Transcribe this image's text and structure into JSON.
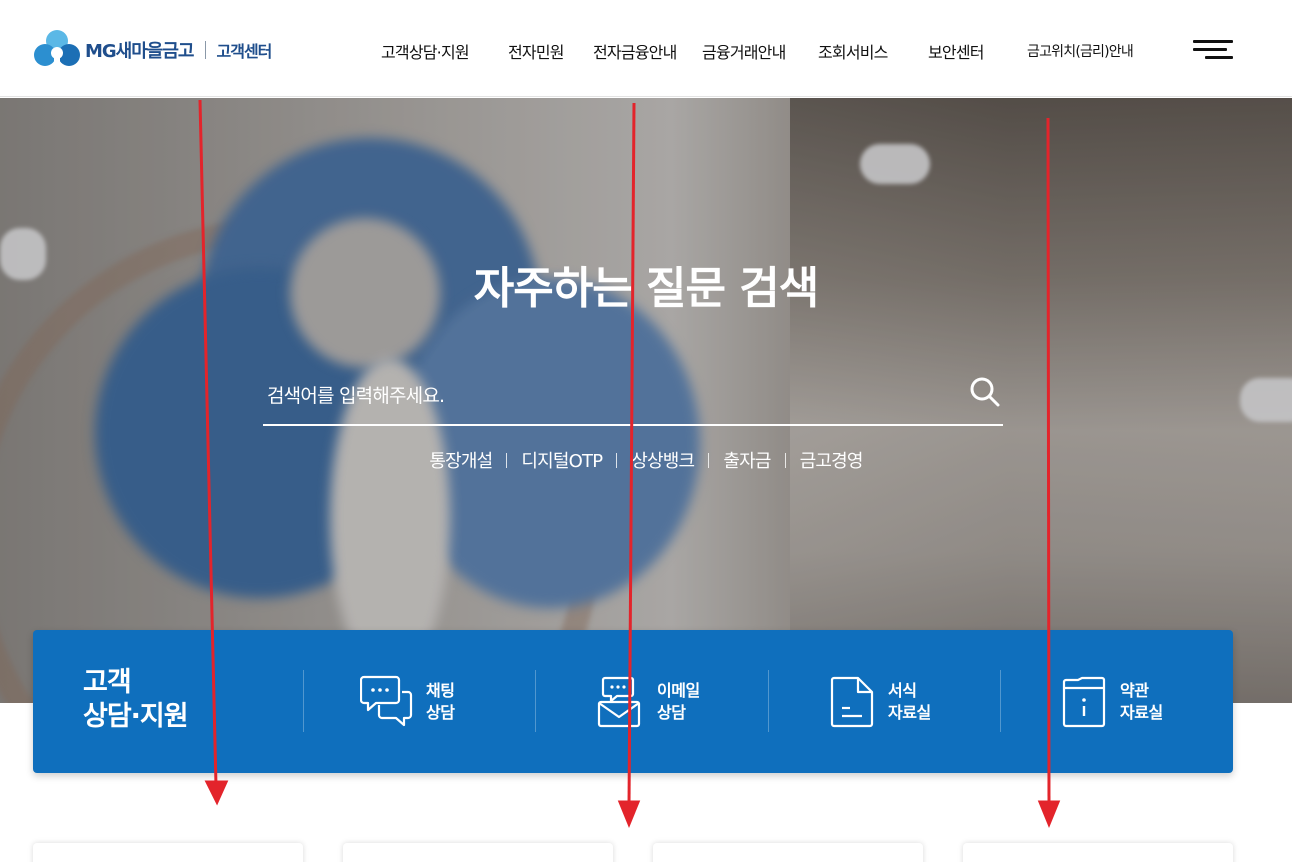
{
  "header": {
    "logo_text": "MG새마을금고",
    "logo_sub": "고객센터",
    "nav": [
      {
        "label": "고객상담·지원"
      },
      {
        "label": "전자민원"
      },
      {
        "label": "전자금융안내"
      },
      {
        "label": "금융거래안내"
      },
      {
        "label": "조회서비스"
      },
      {
        "label": "보안센터"
      },
      {
        "label": "금고위치(금리)안내"
      }
    ]
  },
  "hero": {
    "title": "자주하는 질문 검색",
    "search_placeholder": "검색어를 입력해주세요.",
    "keywords": [
      "통장개설",
      "디지털OTP",
      "상상뱅크",
      "출자금",
      "금고경영"
    ]
  },
  "quick": {
    "title_line1": "고객",
    "title_line2": "상담·지원",
    "items": [
      {
        "line1": "채팅",
        "line2": "상담",
        "icon": "chat-icon"
      },
      {
        "line1": "이메일",
        "line2": "상담",
        "icon": "email-icon"
      },
      {
        "line1": "서식",
        "line2": "자료실",
        "icon": "document-icon"
      },
      {
        "line1": "약관",
        "line2": "자료실",
        "icon": "terms-icon"
      }
    ]
  },
  "colors": {
    "brand_blue": "#0f6fbd",
    "logo_blue": "#1f4e8c",
    "arrow_red": "#e3242b"
  }
}
